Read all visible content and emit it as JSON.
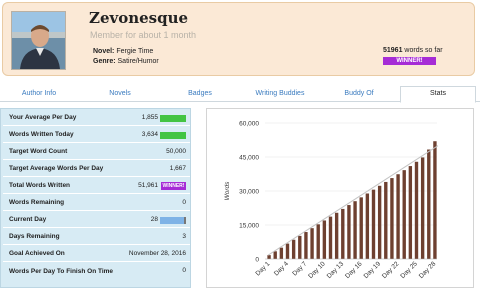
{
  "profile": {
    "username": "Zevonesque",
    "member_since": "Member for about 1 month",
    "novel_label": "Novel:",
    "novel_title": "Fergie Time",
    "genre_label": "Genre:",
    "genre": "Satire/Humor",
    "words_count": "51961",
    "words_suffix": "words so far",
    "winner_label": "WINNER!"
  },
  "tabs": [
    {
      "label": "Author Info"
    },
    {
      "label": "Novels"
    },
    {
      "label": "Badges"
    },
    {
      "label": "Writing Buddies"
    },
    {
      "label": "Buddy Of"
    },
    {
      "label": "Stats"
    }
  ],
  "stats": [
    {
      "label": "Your Average Per Day",
      "value": "1,855",
      "bar": "green",
      "fill": 1.0
    },
    {
      "label": "Words Written Today",
      "value": "3,634",
      "bar": "green",
      "fill": 1.0
    },
    {
      "label": "Target Word Count",
      "value": "50,000"
    },
    {
      "label": "Target Average Words Per Day",
      "value": "1,667"
    },
    {
      "label": "Total Words Written",
      "value": "51,961",
      "badge": "WINNER!"
    },
    {
      "label": "Words Remaining",
      "value": "0"
    },
    {
      "label": "Current Day",
      "value": "28",
      "bar": "blue",
      "fill": 0.93
    },
    {
      "label": "Days Remaining",
      "value": "3"
    },
    {
      "label": "Goal Achieved On",
      "value": "November 28, 2016"
    },
    {
      "label": "Words Per Day To Finish On Time",
      "value": "0"
    }
  ],
  "colors": {
    "bar": "#6e4030",
    "target_line": "#c4c4c4",
    "winner": "#a62cd6",
    "green_bar": "#43c443",
    "blue_bar": "#7fb3e6"
  },
  "chart_data": {
    "type": "bar",
    "ylabel": "Words",
    "ylim": [
      0,
      60000
    ],
    "yticks": [
      "0",
      "15,000",
      "30,000",
      "45,000",
      "60,000"
    ],
    "ytick_values": [
      0,
      15000,
      30000,
      45000,
      60000
    ],
    "grid": true,
    "categories": [
      "Day 1",
      "Day 2",
      "Day 3",
      "Day 4",
      "Day 5",
      "Day 6",
      "Day 7",
      "Day 8",
      "Day 9",
      "Day 10",
      "Day 11",
      "Day 12",
      "Day 13",
      "Day 14",
      "Day 15",
      "Day 16",
      "Day 17",
      "Day 18",
      "Day 19",
      "Day 20",
      "Day 21",
      "Day 22",
      "Day 23",
      "Day 24",
      "Day 25",
      "Day 26",
      "Day 27",
      "Day 28"
    ],
    "tick_labels": [
      "Day 1",
      "Day 4",
      "Day 7",
      "Day 10",
      "Day 13",
      "Day 16",
      "Day 19",
      "Day 22",
      "Day 25",
      "Day 28"
    ],
    "values": [
      1700,
      3400,
      5000,
      6800,
      8500,
      10200,
      11900,
      13600,
      15300,
      17000,
      18700,
      20400,
      22100,
      23800,
      25500,
      27200,
      28900,
      30600,
      32300,
      34000,
      35700,
      37400,
      39200,
      41000,
      42900,
      44800,
      48300,
      51961
    ],
    "target_line": {
      "start": 1667,
      "end": 50000
    }
  }
}
